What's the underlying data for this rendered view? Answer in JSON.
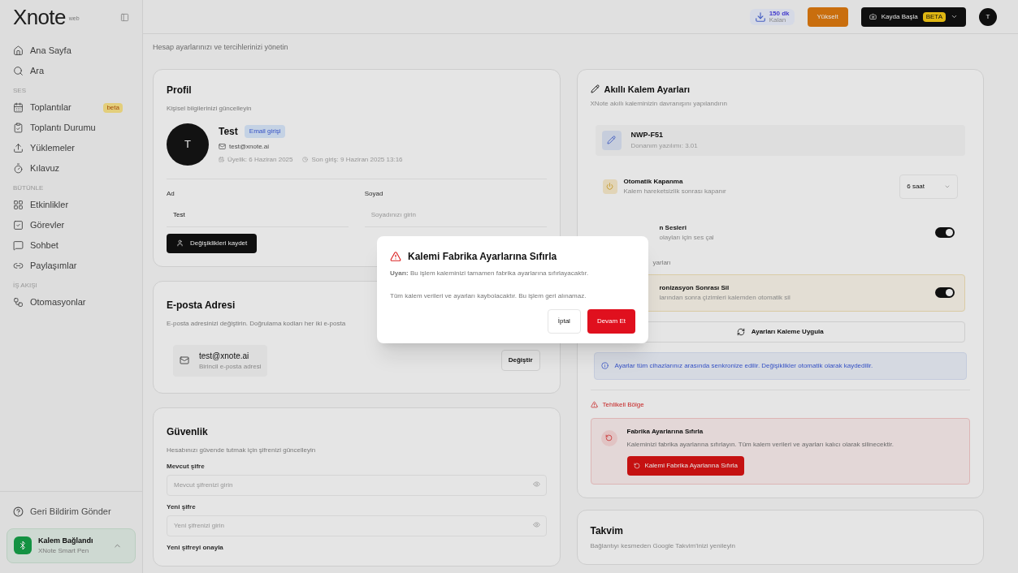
{
  "sidebar": {
    "logo": "Xnote",
    "logo_tag": "web",
    "items_top": [
      {
        "label": "Ana Sayfa"
      },
      {
        "label": "Ara"
      }
    ],
    "sections": [
      {
        "heading": "SES",
        "items": [
          {
            "label": "Toplantılar",
            "badge": "beta"
          },
          {
            "label": "Toplantı Durumu"
          },
          {
            "label": "Yüklemeler"
          },
          {
            "label": "Kılavuz"
          }
        ]
      },
      {
        "heading": "BÜTÜNLE",
        "items": [
          {
            "label": "Etkinlikler"
          },
          {
            "label": "Görevler"
          },
          {
            "label": "Sohbet"
          },
          {
            "label": "Paylaşımlar"
          }
        ]
      },
      {
        "heading": "İŞ AKIŞI",
        "items": [
          {
            "label": "Otomasyonlar"
          }
        ]
      }
    ],
    "feedback": "Geri Bildirim Gönder",
    "pen_status": {
      "title": "Kalem Bağlandı",
      "subtitle": "XNote Smart Pen"
    }
  },
  "header": {
    "minutes": "150 dk",
    "minutes_label": "Kalan",
    "upgrade": "Yükselt",
    "record": "Kayda Başla",
    "record_badge": "BETA",
    "avatar": "T"
  },
  "subtitle": "Hesap ayarlarınızı ve tercihlerinizi yönetin",
  "profile": {
    "title": "Profil",
    "description": "Kişisel bilgilerinizi güncelleyin",
    "avatar": "T",
    "name": "Test",
    "badge": "Email girişi",
    "email": "test@xnote.ai",
    "joined": "Üyelik: 6 Haziran 2025",
    "last_login": "Son giriş: 9 Haziran 2025 13:16",
    "fields": [
      {
        "label": "Ad",
        "value": "Test"
      },
      {
        "label": "Soyad",
        "placeholder": "Soyadınızı girin"
      }
    ],
    "save": "Değişiklikleri kaydet"
  },
  "email_card": {
    "title": "E-posta Adresi",
    "description": "E-posta adresinizi değiştirin. Doğrulama kodları her iki e-posta",
    "email": "test@xnote.ai",
    "email_note": "Birincil e-posta adresi",
    "change": "Değiştir"
  },
  "security": {
    "title": "Güvenlik",
    "description": "Hesabınızı güvende tutmak için şifrenizi güncelleyin",
    "fields": [
      {
        "label": "Mevcut şifre",
        "placeholder": "Mevcut şifrenizi girin"
      },
      {
        "label": "Yeni şifre",
        "placeholder": "Yeni şifrenizi girin"
      },
      {
        "label": "Yeni şifreyi onayla"
      }
    ]
  },
  "pen": {
    "title": "Akıllı Kalem Ayarları",
    "description": "XNote akıllı kaleminizin davranışını yapılandırın",
    "device": "NWP-F51",
    "firmware": "Donanım yazılımı: 3.01",
    "rows": [
      {
        "kind": "select",
        "title": "Otomatik Kapanma",
        "subtitle": "Kalem hareketsizlik sonrası kapanır",
        "value": "6 saat"
      },
      {
        "kind": "toggle",
        "title": "n Sesleri",
        "subtitle": "olayları için ses çal",
        "on": true,
        "highlight": false
      },
      {
        "kind": "heading",
        "title": "yarları"
      },
      {
        "kind": "toggle",
        "title": "ronizasyon Sonrası Sil",
        "subtitle": "larından sonra çizimleri kalemden otomatik sil",
        "on": true,
        "highlight": true
      }
    ],
    "apply": "Ayarları Kaleme Uygula",
    "info": "Ayarlar tüm cihazlarınız arasında senkronize edilir. Değişiklikler otomatik olarak kaydedilir.",
    "danger": {
      "heading": "Tehlikeli Bölge",
      "title": "Fabrika Ayarlarına Sıfırla",
      "text": "Kaleminizi fabrika ayarlarına sıfırlayın. Tüm kalem verileri ve ayarları kalıcı olarak silinecektir.",
      "button": "Kalemi Fabrika Ayarlarına Sıfırla"
    }
  },
  "calendar": {
    "title": "Takvim",
    "description": "Bağlantıyı kesmeden Google Takvim'inizi yenileyin"
  },
  "dialog": {
    "title": "Kalemi Fabrika Ayarlarına Sıfırla",
    "warning": "**Uyarı:** Bu işlem kaleminizi tamamen fabrika ayarlarına sıfırlayacaktır.",
    "text": "Tüm kalem verileri ve ayarları kaybolacaktır. Bu işlem geri alınamaz.",
    "cancel": "İptal",
    "confirm": "Devam Et"
  }
}
